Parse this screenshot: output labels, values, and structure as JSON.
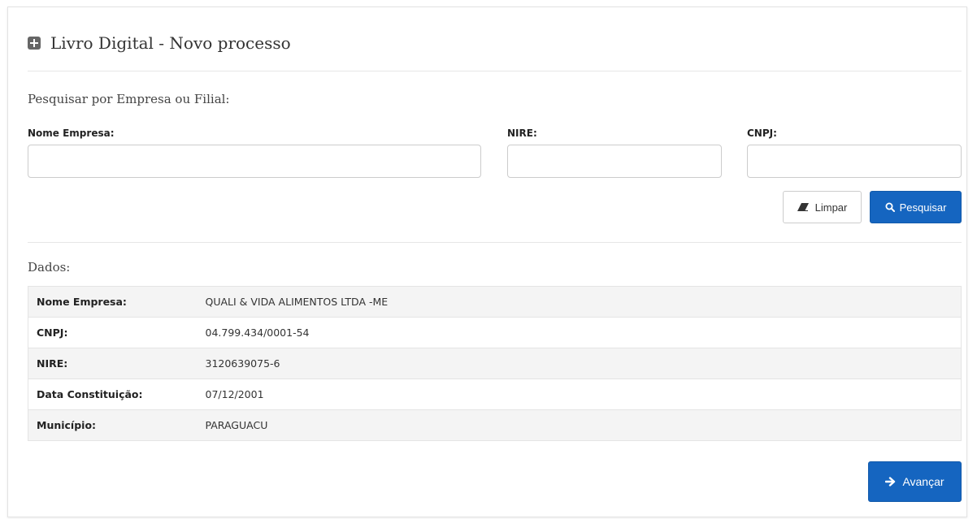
{
  "header": {
    "title": "Livro Digital - Novo processo"
  },
  "search": {
    "section_title": "Pesquisar por Empresa ou Filial:",
    "fields": {
      "nome_empresa": {
        "label": "Nome Empresa:",
        "value": "",
        "placeholder": ""
      },
      "nire": {
        "label": "NIRE:",
        "value": "",
        "placeholder": ""
      },
      "cnpj": {
        "label": "CNPJ:",
        "value": "",
        "placeholder": ""
      }
    },
    "clear_label": "Limpar",
    "search_label": "Pesquisar"
  },
  "dados": {
    "section_title": "Dados:",
    "rows": [
      {
        "label": "Nome Empresa:",
        "value": "QUALI & VIDA ALIMENTOS LTDA -ME"
      },
      {
        "label": "CNPJ:",
        "value": "04.799.434/0001-54"
      },
      {
        "label": "NIRE:",
        "value": "3120639075-6"
      },
      {
        "label": "Data Constituição:",
        "value": "07/12/2001"
      },
      {
        "label": "Município:",
        "value": "PARAGUACU"
      }
    ]
  },
  "footer": {
    "next_label": "Avançar"
  },
  "colors": {
    "primary": "#1565c0",
    "row_alt": "#f4f4f4",
    "border": "#e4e4e4"
  },
  "icons": {
    "title": "plus-square-icon",
    "clear": "eraser-icon",
    "search": "search-icon",
    "next": "arrow-right-icon"
  }
}
